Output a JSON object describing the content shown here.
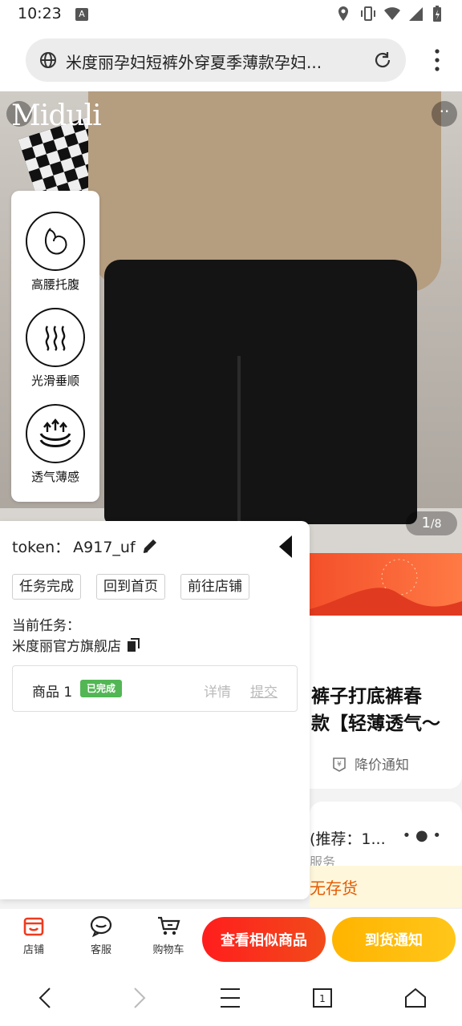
{
  "status_bar": {
    "time": "10:23"
  },
  "browser": {
    "url_text": "米度丽孕妇短裤外穿夏季薄款孕妇..."
  },
  "hero": {
    "brand": "Miduli",
    "image_counter_current": "1",
    "image_counter_total": "/8"
  },
  "features": [
    {
      "label": "高腰托腹",
      "icon": "belly-icon"
    },
    {
      "label": "光滑垂顺",
      "icon": "waves-icon"
    },
    {
      "label": "透气薄感",
      "icon": "breathable-icon"
    }
  ],
  "product": {
    "title_line1": "裤子打底裤春",
    "title_line2": "款【轻薄透气〜",
    "price_notice": "降价通知",
    "spec_text": "(推荐：1...",
    "service_text": "服务",
    "stock_text": "无存货"
  },
  "panel": {
    "token_label": "token：",
    "token_value": "A917_uf",
    "buttons": {
      "done": "任务完成",
      "home": "回到首页",
      "shop": "前往店铺"
    },
    "task_label": "当前任务：",
    "task_shop": "米度丽官方旗舰店",
    "item": {
      "name": "商品 1",
      "badge": "已完成",
      "detail": "详情",
      "submit": "提交"
    }
  },
  "actions": {
    "shop": "店铺",
    "service": "客服",
    "cart": "购物车",
    "similar": "查看相似商品",
    "notify": "到货通知"
  },
  "colors": {
    "accent_red": "#ff1d1d",
    "accent_yellow": "#ffb400",
    "success_green": "#52b654"
  }
}
